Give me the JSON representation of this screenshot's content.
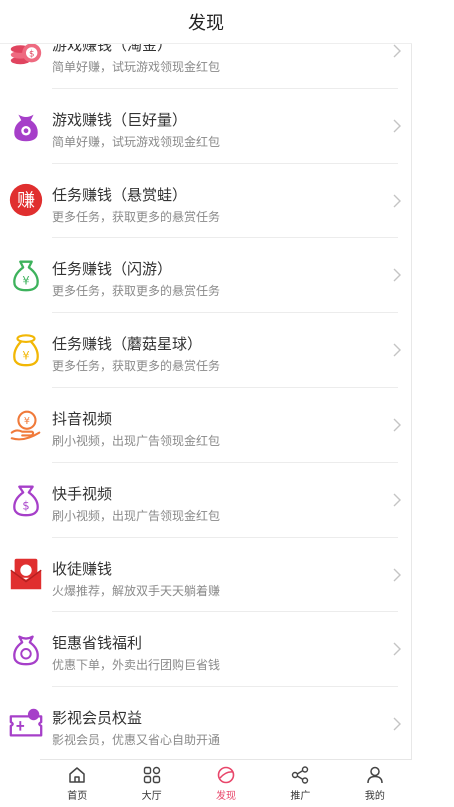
{
  "header": {
    "title": "发现"
  },
  "items": [
    {
      "title": "游戏赚钱（淘金）",
      "subtitle": "简单好赚，试玩游戏领现金红包",
      "icon": "coins-stack-icon"
    },
    {
      "title": "游戏赚钱（巨好量）",
      "subtitle": "简单好赚，试玩游戏领现金红包",
      "icon": "purple-money-bag-icon"
    },
    {
      "title": "任务赚钱（悬赏蛙）",
      "subtitle": "更多任务，获取更多的悬赏任务",
      "icon": "red-zhuan-badge-icon",
      "badge_char": "赚"
    },
    {
      "title": "任务赚钱（闪游）",
      "subtitle": "更多任务，获取更多的悬赏任务",
      "icon": "green-money-bag-icon"
    },
    {
      "title": "任务赚钱（蘑菇星球）",
      "subtitle": "更多任务，获取更多的悬赏任务",
      "icon": "yellow-money-bag-icon"
    },
    {
      "title": "抖音视频",
      "subtitle": "刷小视频，出现广告领现金红包",
      "icon": "hand-coin-icon"
    },
    {
      "title": "快手视频",
      "subtitle": "刷小视频，出现广告领现金红包",
      "icon": "dollar-bag-icon"
    },
    {
      "title": "收徒赚钱",
      "subtitle": "火爆推荐，解放双手天天躺着赚",
      "icon": "red-envelope-icon"
    },
    {
      "title": "钜惠省钱福利",
      "subtitle": "优惠下单，外卖出行团购巨省钱",
      "icon": "purple-pouch-icon"
    },
    {
      "title": "影视会员权益",
      "subtitle": "影视会员，优惠又省心自助开通",
      "icon": "ticket-icon"
    }
  ],
  "tabbar": [
    {
      "label": "首页",
      "icon": "home-icon"
    },
    {
      "label": "大厅",
      "icon": "grid-icon"
    },
    {
      "label": "发现",
      "icon": "discover-icon",
      "active": true
    },
    {
      "label": "推广",
      "icon": "share-icon"
    },
    {
      "label": "我的",
      "icon": "user-icon"
    }
  ],
  "colors": {
    "accent": "#e8466a",
    "purple": "#a63fc9",
    "red": "#e02f2f",
    "green": "#3db25c",
    "yellow": "#f2b705",
    "orange": "#f07a3a"
  }
}
